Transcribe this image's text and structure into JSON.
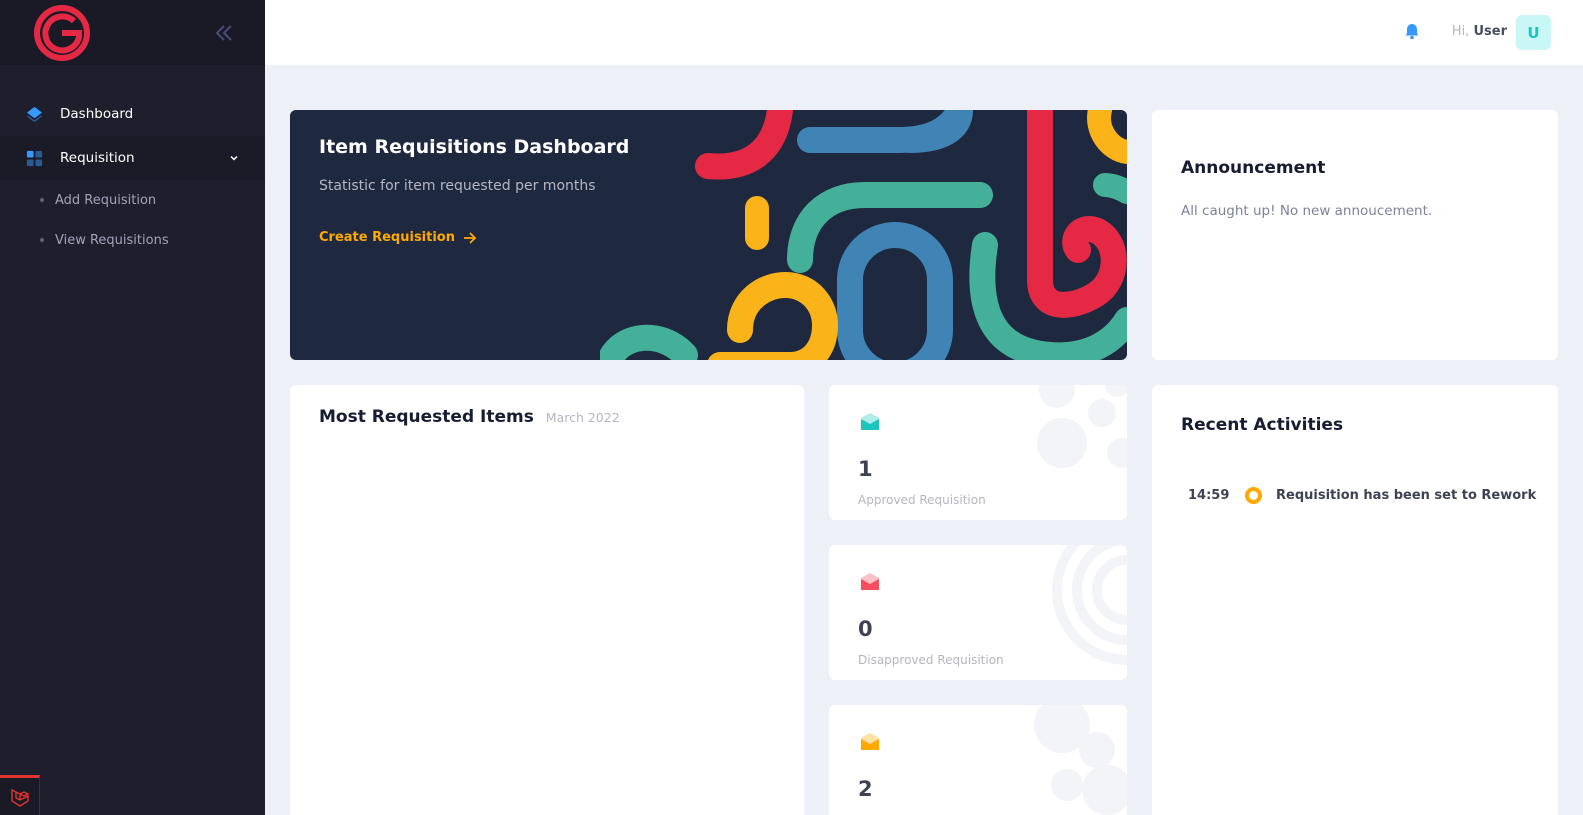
{
  "sidebar": {
    "logo_letter": "G",
    "items": [
      {
        "label": "Dashboard",
        "icon": "layers-icon"
      },
      {
        "label": "Requisition",
        "icon": "grid-icon"
      }
    ],
    "subitems": [
      {
        "label": "Add Requisition"
      },
      {
        "label": "View Requisitions"
      }
    ]
  },
  "header": {
    "greeting": "Hi,",
    "user_name": "User",
    "avatar_letter": "U"
  },
  "hero": {
    "title": "Item Requisitions Dashboard",
    "subtitle": "Statistic for item requested per months",
    "link_label": "Create Requisition"
  },
  "announcement": {
    "title": "Announcement",
    "text": "All caught up! No new annoucement."
  },
  "most_requested": {
    "title": "Most Requested Items",
    "period": "March 2022"
  },
  "stats": [
    {
      "value": "1",
      "label": "Approved Requisition",
      "icon": "envelope-icon",
      "color": "#1bc5bd"
    },
    {
      "value": "0",
      "label": "Disapproved Requisition",
      "icon": "envelope-icon",
      "color": "#f64e60"
    },
    {
      "value": "2",
      "label": "",
      "icon": "envelope-icon",
      "color": "#ffa800"
    }
  ],
  "recent": {
    "title": "Recent Activities",
    "items": [
      {
        "time": "14:59",
        "text": "Requisition has been set to Rework"
      }
    ]
  },
  "colors": {
    "sidebar_bg": "#1e1e2d",
    "accent_blue": "#3699ff",
    "warning": "#ffa800",
    "danger": "#f64e60",
    "success": "#1bc5bd",
    "hero_bg": "#1e2940"
  }
}
